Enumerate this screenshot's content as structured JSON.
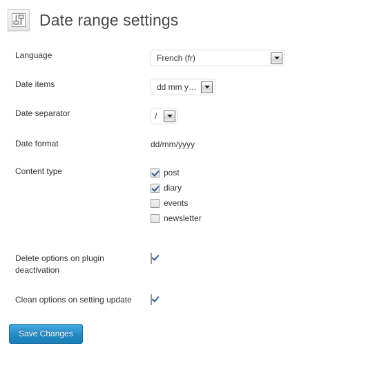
{
  "header": {
    "icon": "settings-sliders-icon",
    "title": "Date range settings"
  },
  "form": {
    "rows": [
      {
        "label": "Language",
        "control": "select",
        "value": "French (fr)"
      },
      {
        "label": "Date items",
        "control": "select",
        "value": "dd mm yyyy"
      },
      {
        "label": "Date separator",
        "control": "select",
        "value": "/"
      },
      {
        "label": "Date format",
        "control": "static",
        "value": "dd/mm/yyyy"
      }
    ],
    "content_type": {
      "label": "Content type",
      "options": [
        {
          "label": "post",
          "checked": true
        },
        {
          "label": "diary",
          "checked": true
        },
        {
          "label": "events",
          "checked": false
        },
        {
          "label": "newsletter",
          "checked": false
        }
      ]
    },
    "delete_options": {
      "label": "Delete options on plugin deactivation",
      "checked": true
    },
    "clean_options": {
      "label": "Clean options on setting update",
      "checked": true
    }
  },
  "submit": {
    "label": "Save Changes"
  },
  "colors": {
    "title": "#464646",
    "text": "#333333",
    "primary_button": "#2f92cc",
    "check_mark": "#2b5a9b",
    "select_border": "#dfdfdf"
  }
}
